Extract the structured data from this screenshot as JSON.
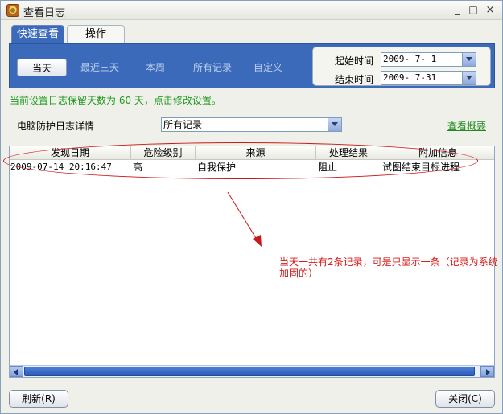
{
  "window": {
    "title": "查看日志"
  },
  "title_buttons": {
    "minimize": "_",
    "maximize": "□",
    "close": "×"
  },
  "tabs": [
    {
      "label": "快速查看",
      "active": true
    },
    {
      "label": "操作",
      "active": false
    }
  ],
  "range_buttons": [
    {
      "label": "当天",
      "selected": true
    },
    {
      "label": "最近三天"
    },
    {
      "label": "本周"
    },
    {
      "label": "所有记录"
    },
    {
      "label": "自定义"
    }
  ],
  "dates": {
    "start_label": "起始时间",
    "start_value": "2009- 7- 1",
    "end_label": "结束时间",
    "end_value": "2009- 7-31"
  },
  "notice": "当前设置日志保留天数为 60 天，点击修改设置。",
  "filter": {
    "label": "电脑防护日志详情",
    "value": "所有记录",
    "summary_link": "查看概要"
  },
  "table": {
    "columns": [
      "发现日期",
      "危险级别",
      "来源",
      "处理结果",
      "附加信息"
    ],
    "rows": [
      [
        "2009-07-14 20:16:47",
        "高",
        "自我保护",
        "阻止",
        "试图结束目标进程"
      ]
    ]
  },
  "annotation": "当天一共有2条记录，可是只显示一条（记录为系统加固的）",
  "buttons": {
    "refresh": "刷新(R)",
    "close": "关闭(C)"
  },
  "colors": {
    "accent_blue": "#3c6aba",
    "notice_green": "#1f9a1f",
    "annotation_red": "#d61a1a"
  }
}
